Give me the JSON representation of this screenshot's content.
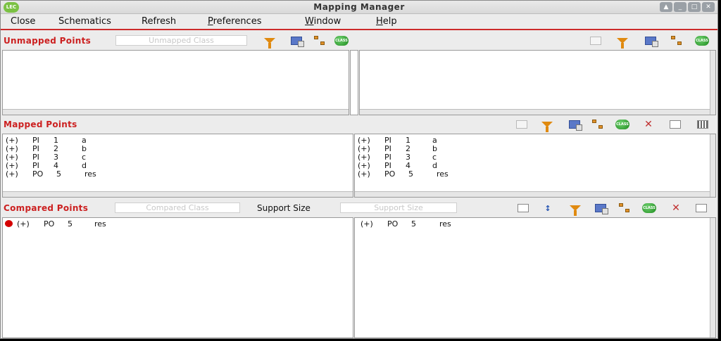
{
  "window": {
    "title": "Mapping Manager",
    "logo": "LEC"
  },
  "menu": [
    {
      "label": "Close",
      "mnemonic": ""
    },
    {
      "label": "Schematics",
      "mnemonic": ""
    },
    {
      "label": "Refresh",
      "mnemonic": ""
    },
    {
      "label": "Preferences",
      "mnemonic": "P"
    },
    {
      "label": "Window",
      "mnemonic": "W"
    },
    {
      "label": "Help",
      "mnemonic": "H"
    }
  ],
  "unmapped": {
    "title": "Unmapped Points",
    "class_placeholder": "Unmapped Class",
    "left_items": [],
    "right_items": []
  },
  "mapped": {
    "title": "Mapped Points",
    "left_items": [
      {
        "sign": "(+)",
        "type": "PI",
        "id": "1",
        "name": "a"
      },
      {
        "sign": "(+)",
        "type": "PI",
        "id": "2",
        "name": "b"
      },
      {
        "sign": "(+)",
        "type": "PI",
        "id": "3",
        "name": "c"
      },
      {
        "sign": "(+)",
        "type": "PI",
        "id": "4",
        "name": "d"
      },
      {
        "sign": "(+)",
        "type": "PO",
        "id": "5",
        "name": "res"
      }
    ],
    "right_items": [
      {
        "sign": "(+)",
        "type": "PI",
        "id": "1",
        "name": "a"
      },
      {
        "sign": "(+)",
        "type": "PI",
        "id": "2",
        "name": "b"
      },
      {
        "sign": "(+)",
        "type": "PI",
        "id": "3",
        "name": "c"
      },
      {
        "sign": "(+)",
        "type": "PI",
        "id": "4",
        "name": "d"
      },
      {
        "sign": "(+)",
        "type": "PO",
        "id": "5",
        "name": "res"
      }
    ]
  },
  "compared": {
    "title": "Compared Points",
    "class_placeholder": "Compared Class",
    "support_size_label": "Support Size",
    "support_size_placeholder": "Support Size",
    "left_items": [
      {
        "sign": "(+)",
        "type": "PO",
        "id": "5",
        "name": "res",
        "status": "red-dot"
      }
    ],
    "right_items": [
      {
        "sign": "(+)",
        "type": "PO",
        "id": "5",
        "name": "res"
      }
    ]
  },
  "icons": {
    "filter": "filter-icon",
    "class": "class-icon",
    "schematic": "schematic-icon",
    "hierarchy": "hierarchy-icon",
    "delete": "delete-icon",
    "sort": "sort-icon",
    "class_label": "CLASS"
  },
  "colors": {
    "accent_red": "#cc2020",
    "status_red": "#d40000",
    "class_green": "#1c8a1c",
    "filter_orange": "#e08a10"
  }
}
